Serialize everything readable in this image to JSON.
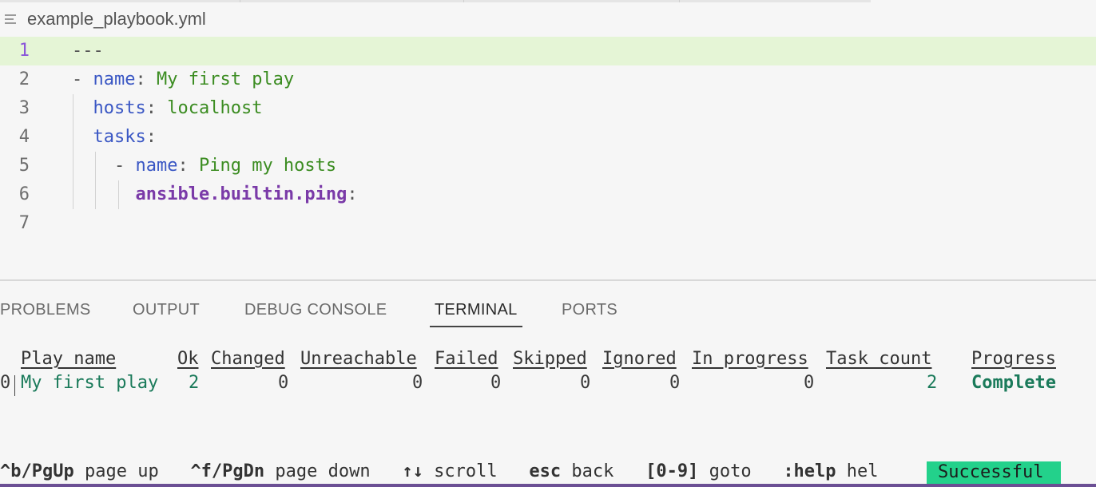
{
  "editor": {
    "file_name": "example_playbook.yml",
    "lines": [
      {
        "num": "1",
        "tokens": [
          {
            "t": "---",
            "c": "p"
          }
        ]
      },
      {
        "num": "2",
        "tokens": [
          {
            "t": "- ",
            "c": "p"
          },
          {
            "t": "name",
            "c": "k"
          },
          {
            "t": ": ",
            "c": "p"
          },
          {
            "t": "My first play",
            "c": "v"
          }
        ]
      },
      {
        "num": "3",
        "tokens": [
          {
            "t": "  ",
            "c": "p"
          },
          {
            "t": "hosts",
            "c": "k"
          },
          {
            "t": ": ",
            "c": "p"
          },
          {
            "t": "localhost",
            "c": "v"
          }
        ]
      },
      {
        "num": "4",
        "tokens": [
          {
            "t": "  ",
            "c": "p"
          },
          {
            "t": "tasks",
            "c": "k"
          },
          {
            "t": ":",
            "c": "p"
          }
        ]
      },
      {
        "num": "5",
        "tokens": [
          {
            "t": "    - ",
            "c": "p"
          },
          {
            "t": "name",
            "c": "k"
          },
          {
            "t": ": ",
            "c": "p"
          },
          {
            "t": "Ping my hosts",
            "c": "v"
          }
        ]
      },
      {
        "num": "6",
        "tokens": [
          {
            "t": "      ",
            "c": "p"
          },
          {
            "t": "ansible.builtin.ping",
            "c": "m"
          },
          {
            "t": ":",
            "c": "p"
          }
        ]
      },
      {
        "num": "7",
        "tokens": []
      }
    ],
    "current_line": "1"
  },
  "panel": {
    "tabs": [
      {
        "label": "PROBLEMS",
        "active": false
      },
      {
        "label": "OUTPUT",
        "active": false
      },
      {
        "label": "DEBUG CONSOLE",
        "active": false
      },
      {
        "label": "TERMINAL",
        "active": true
      },
      {
        "label": "PORTS",
        "active": false
      }
    ]
  },
  "terminal": {
    "headers": {
      "play_name": "Play name",
      "ok": "Ok",
      "changed": "Changed",
      "unreachable": "Unreachable",
      "failed": "Failed",
      "skipped": "Skipped",
      "ignored": "Ignored",
      "in_progress": "In progress",
      "task_count": "Task count",
      "progress": "Progress"
    },
    "row": {
      "index": "0",
      "play_name": "My first play",
      "ok": "2",
      "changed": "0",
      "unreachable": "0",
      "failed": "0",
      "skipped": "0",
      "ignored": "0",
      "in_progress": "0",
      "task_count": "2",
      "progress": "Complete"
    },
    "footer": [
      {
        "key": "^b/PgUp",
        "desc": "page up"
      },
      {
        "key": "^f/PgDn",
        "desc": "page down"
      },
      {
        "key": "↑↓",
        "desc": "scroll"
      },
      {
        "key": "esc",
        "desc": "back"
      },
      {
        "key": "[0-9]",
        "desc": "goto"
      },
      {
        "key": ":help",
        "desc": "hel"
      }
    ],
    "status": "Successful"
  },
  "colors": {
    "current_line_bg": "#e5f5d6",
    "status_bg": "#23d18b",
    "status_bar": "#6b4f94"
  }
}
